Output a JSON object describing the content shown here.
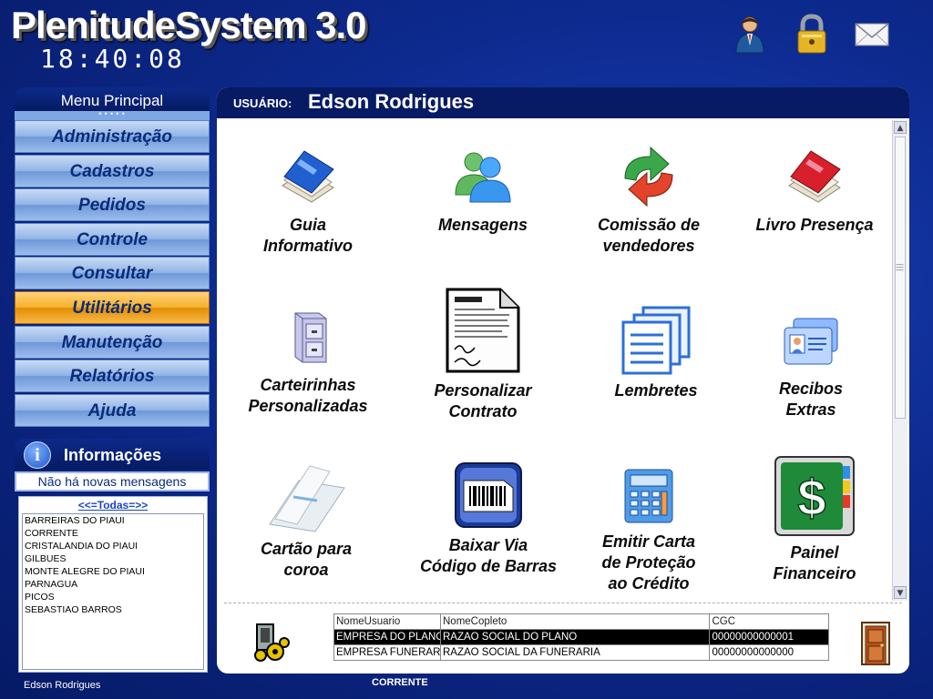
{
  "app": {
    "title": "PlenitudeSystem 3.0",
    "clock": "18:40:08"
  },
  "top_icons": [
    "user-icon",
    "lock-icon",
    "mail-icon"
  ],
  "sidebar": {
    "title": "Menu Principal",
    "items": [
      {
        "label": "Administração",
        "active": false
      },
      {
        "label": "Cadastros",
        "active": false
      },
      {
        "label": "Pedidos",
        "active": false
      },
      {
        "label": "Controle",
        "active": false
      },
      {
        "label": "Consultar",
        "active": false
      },
      {
        "label": "Utilitários",
        "active": true
      },
      {
        "label": "Manutenção",
        "active": false
      },
      {
        "label": "Relatórios",
        "active": false
      },
      {
        "label": "Ajuda",
        "active": false
      }
    ]
  },
  "info": {
    "title": "Informações",
    "message": "Não há novas mensagens",
    "filter_all": "<<=Todas=>>",
    "cities": [
      "BARREIRAS DO PIAUI",
      "CORRENTE",
      "CRISTALANDIA DO PIAUI",
      "GILBUES",
      "MONTE ALEGRE DO PIAUI",
      "PARNAGUA",
      "PICOS",
      "SEBASTIAO BARROS"
    ]
  },
  "main": {
    "user_label": "USUÁRIO:",
    "user_name": "Edson Rodrigues",
    "tiles": [
      {
        "label": "Guia\nInformativo",
        "icon": "book-icon"
      },
      {
        "label": "Mensagens",
        "icon": "people-icon"
      },
      {
        "label": "Comissão de\nvendedores",
        "icon": "exchange-arrows-icon"
      },
      {
        "label": "Livro Presença",
        "icon": "red-book-icon"
      },
      {
        "label": "Carteirinhas\nPersonalizadas",
        "icon": "file-cabinet-icon"
      },
      {
        "label": "Personalizar\nContrato",
        "icon": "contract-icon"
      },
      {
        "label": "Lembretes",
        "icon": "documents-icon"
      },
      {
        "label": "Recibos\nExtras",
        "icon": "id-card-icon"
      },
      {
        "label": "Cartão para\ncoroa",
        "icon": "folder-icon"
      },
      {
        "label": "Baixar Via\nCódigo de Barras",
        "icon": "barcode-icon"
      },
      {
        "label": "Emitir Carta\nde Proteção\nao Crédito",
        "icon": "calculator-icon"
      },
      {
        "label": "Painel\nFinanceiro",
        "icon": "dollar-panel-icon"
      }
    ],
    "table": {
      "headers": [
        "NomeUsuario",
        "NomeCopleto",
        "CGC"
      ],
      "rows": [
        [
          "EMPRESA DO PLANO",
          "RAZAO SOCIAL DO PLANO",
          "00000000000001"
        ],
        [
          "EMPRESA FUNERARIA",
          "RAZAO SOCIAL DA FUNERARIA",
          "00000000000000"
        ]
      ]
    }
  },
  "footer": {
    "user": "Edson Rodrigues",
    "city": "CORRENTE"
  }
}
